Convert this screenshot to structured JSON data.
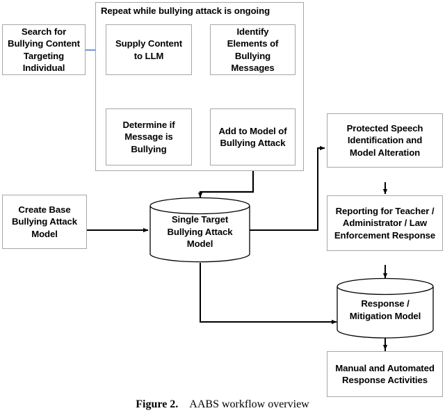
{
  "figure": {
    "caption_number": "Figure 2.",
    "caption_text": "AABS workflow overview",
    "accent_arrow_color": "#4472c4",
    "arrow_color": "#000000",
    "node_border_color": "#a6a6a6"
  },
  "group": {
    "title": "Repeat while bullying attack is ongoing"
  },
  "nodes": {
    "search_content": "Search for\nBullying Content\nTargeting\nIndividual",
    "supply_content": "Supply Content\nto LLM",
    "identify_elements": "Identify\nElements of\nBullying\nMessages",
    "determine_bullying": "Determine if\nMessage is\nBullying",
    "add_to_model": "Add to Model of\nBullying Attack",
    "create_base_model": "Create Base\nBullying Attack\nModel",
    "single_target_model": "Single Target\nBullying Attack\nModel",
    "protected_speech": "Protected Speech\nIdentification and\nModel Alteration",
    "reporting": "Reporting for Teacher /\nAdministrator / Law\nEnforcement Response",
    "response_mitigation_model": "Response /\nMitigation Model",
    "manual_automated": "Manual and Automated\nResponse Activities"
  }
}
